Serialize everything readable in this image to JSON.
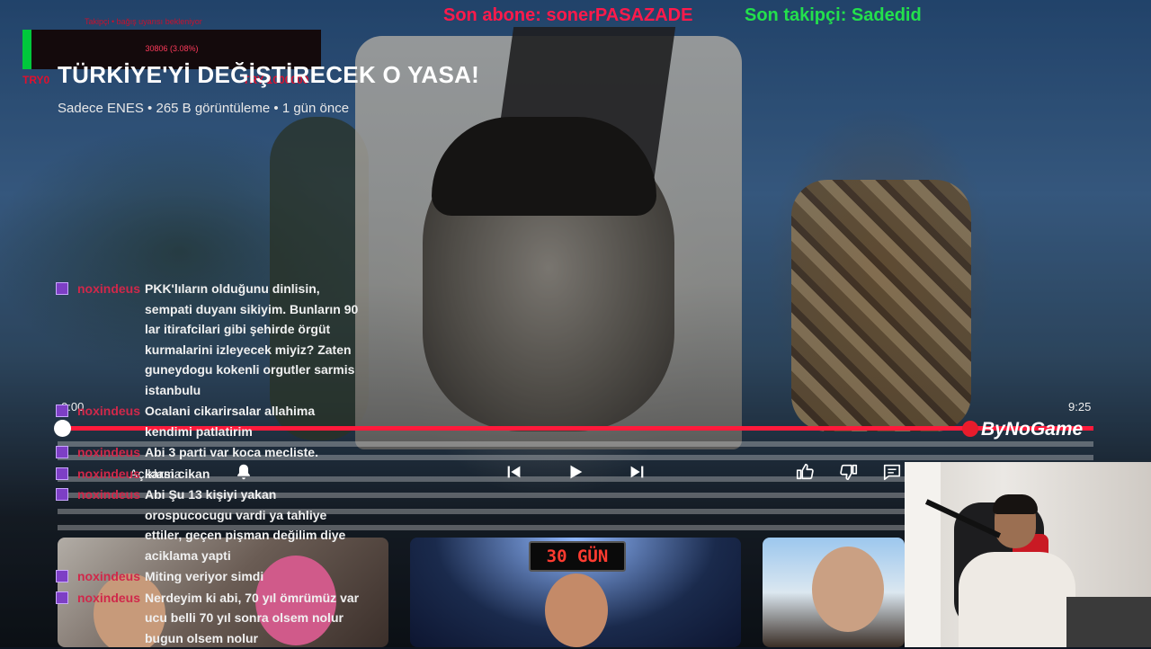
{
  "overlay": {
    "alert_text": "Takipçi • bağış uyarısı bekleniyor",
    "goal_value": "30806 (3.08%)",
    "goal_fill_ratio": 0.03,
    "goal_left": "TRY0",
    "goal_right": "TRY 1000000",
    "last_sub_label": "Son abone: sonerPASAZADE",
    "last_follow_label": "Son takipçi: Sadedid"
  },
  "video": {
    "title": "TÜRKİYE'Yİ DEĞİŞTİRECEK O YASA!",
    "meta": "Sadece ENES • 265 B görüntüleme • 1 gün önce",
    "time_current": "0:00",
    "time_total": "9:25",
    "progress_ratio": 0.0,
    "logo": "ByNoGame",
    "description_label": "Açıklama"
  },
  "controls": [
    {
      "name": "previous-button",
      "icon": "skip-previous-icon"
    },
    {
      "name": "play-button",
      "icon": "play-icon"
    },
    {
      "name": "next-button",
      "icon": "skip-next-icon"
    },
    {
      "name": "like-button",
      "icon": "thumbs-up-icon"
    },
    {
      "name": "dislike-button",
      "icon": "thumbs-down-icon"
    },
    {
      "name": "comments-button",
      "icon": "comment-icon"
    },
    {
      "name": "subscribe-bell-button",
      "icon": "bell-icon"
    }
  ],
  "chat": {
    "messages": [
      {
        "user": "noxindeus",
        "text": "PKK'lıların olduğunu dinlisin, sempati duyanı sikiyim. Bunların 90 lar itirafcilari gibi şehirde örgüt kurmalarini izleyecek miyiz? Zaten guneydogu kokenli orgutler sarmis istanbulu"
      },
      {
        "user": "noxindeus",
        "text": "Ocalani cikarirsalar allahima kendimi patlatirim"
      },
      {
        "user": "noxindeus",
        "text": "Abi 3 parti var koca mecliste."
      },
      {
        "user": "noxindeus",
        "text": "karsi cikan"
      },
      {
        "user": "noxindeus",
        "text": "Abi Şu 13 kişiyi yakan orospucocugu vardi ya tahliye ettiler, geçen pişman değilim diye aciklama yapti"
      },
      {
        "user": "noxindeus",
        "text": "Miting veriyor simdi"
      },
      {
        "user": "noxindeus",
        "text": "Nerdeyim ki abi, 70 yıl ömrümüz var ucu belli 70 yıl sonra olsem nolur bugun olsem nolur"
      }
    ]
  },
  "recommendations": [
    {
      "name": "recommended-video-1",
      "badge": ""
    },
    {
      "name": "recommended-video-2",
      "badge": "30 GÜN"
    },
    {
      "name": "recommended-video-3",
      "badge": ""
    }
  ],
  "colors": {
    "progress": "#ff1a3b",
    "sub_label": "#ff1a4b",
    "follow_label": "#23e04c",
    "chat_user": "#d0284a",
    "goal_fill": "#00c83c"
  }
}
